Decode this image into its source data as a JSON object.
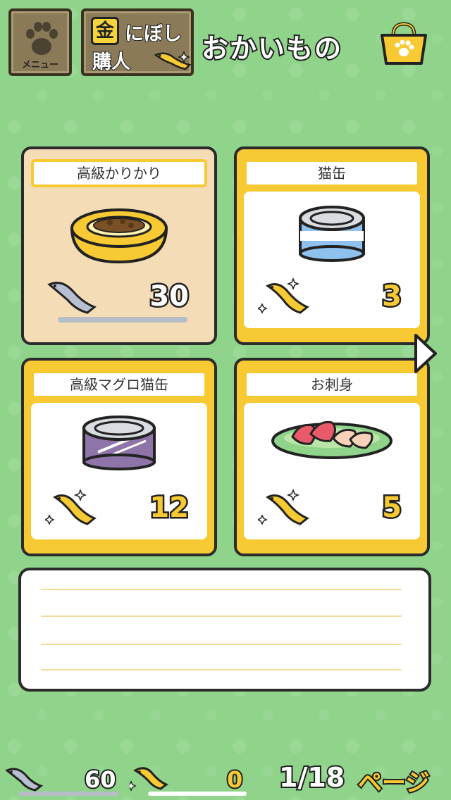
{
  "header": {
    "menu_label": "メニュー",
    "buy_kin": "金",
    "buy_line1": "にぼし",
    "buy_line2": "購人",
    "title": "おかいもの"
  },
  "items": [
    {
      "name": "高級かりかり",
      "price": "30",
      "currency": "silver-niboshi",
      "selected": true
    },
    {
      "name": "猫缶",
      "price": "3",
      "currency": "gold-niboshi",
      "selected": false
    },
    {
      "name": "高級マグロ猫缶",
      "price": "12",
      "currency": "gold-niboshi",
      "selected": false
    },
    {
      "name": "お刺身",
      "price": "5",
      "currency": "gold-niboshi",
      "selected": false
    }
  ],
  "footer": {
    "silver_count": "60",
    "gold_count": "0",
    "page": "1/18",
    "page_label": "ページ"
  },
  "colors": {
    "background": "#8fd48a",
    "card_gold": "#f7c932",
    "card_selected": "#f4dcb6",
    "outline": "#2b2b2b"
  },
  "icons": [
    "paw-icon",
    "shopping-bag-icon",
    "silver-fish-icon",
    "gold-fish-icon",
    "next-arrow-icon"
  ]
}
